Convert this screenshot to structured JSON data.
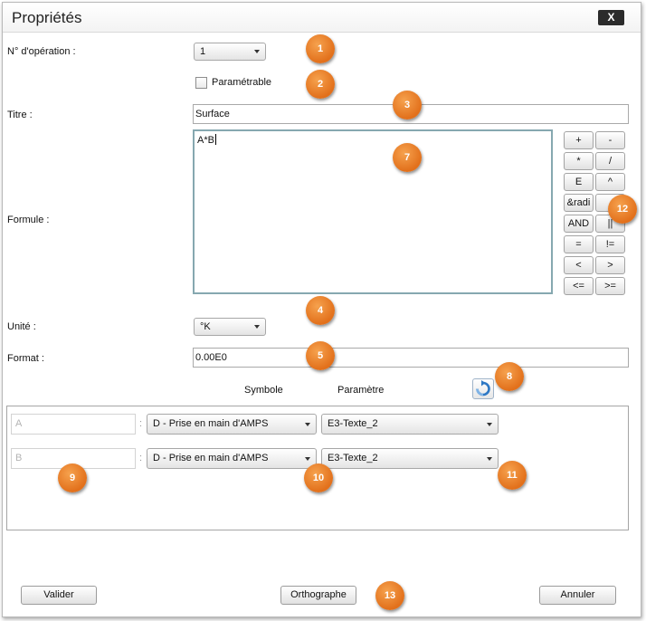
{
  "window": {
    "title": "Propriétés",
    "close_label": "X"
  },
  "fields": {
    "operation_label": "N° d'opération :",
    "operation_value": "1",
    "parametrable_label": "Paramétrable",
    "titre_label": "Titre :",
    "titre_value": "Surface",
    "formule_label": "Formule :",
    "formule_value": "A*B",
    "unite_label": "Unité :",
    "unite_value": "°K",
    "format_label": "Format :",
    "format_value": "0.00E0"
  },
  "keypad": [
    "+",
    "-",
    "*",
    "/",
    "E",
    "^",
    "&radi",
    "",
    "AND",
    "||",
    "=",
    "!=",
    "<",
    ">",
    "<=",
    ">="
  ],
  "mapping": {
    "symbole_header": "Symbole",
    "parametre_header": "Paramètre",
    "rows": [
      {
        "symbol": "A",
        "separator": ":",
        "source": "D - Prise en main d'AMPS",
        "parameter": "E3-Texte_2"
      },
      {
        "symbol": "B",
        "separator": ":",
        "source": "D - Prise en main d'AMPS",
        "parameter": "E3-Texte_2"
      }
    ]
  },
  "buttons": {
    "valider": "Valider",
    "orthographe": "Orthographe",
    "annuler": "Annuler"
  },
  "badges": [
    "1",
    "2",
    "3",
    "4",
    "5",
    "7",
    "8",
    "9",
    "10",
    "11",
    "12",
    "13"
  ],
  "colors": {
    "badge": "#e97a22",
    "formula_border": "#86a8b0",
    "close_button": "#2b2b2b"
  },
  "icons": {
    "refresh": "refresh-icon",
    "dropdown": "chevron-down-icon"
  }
}
